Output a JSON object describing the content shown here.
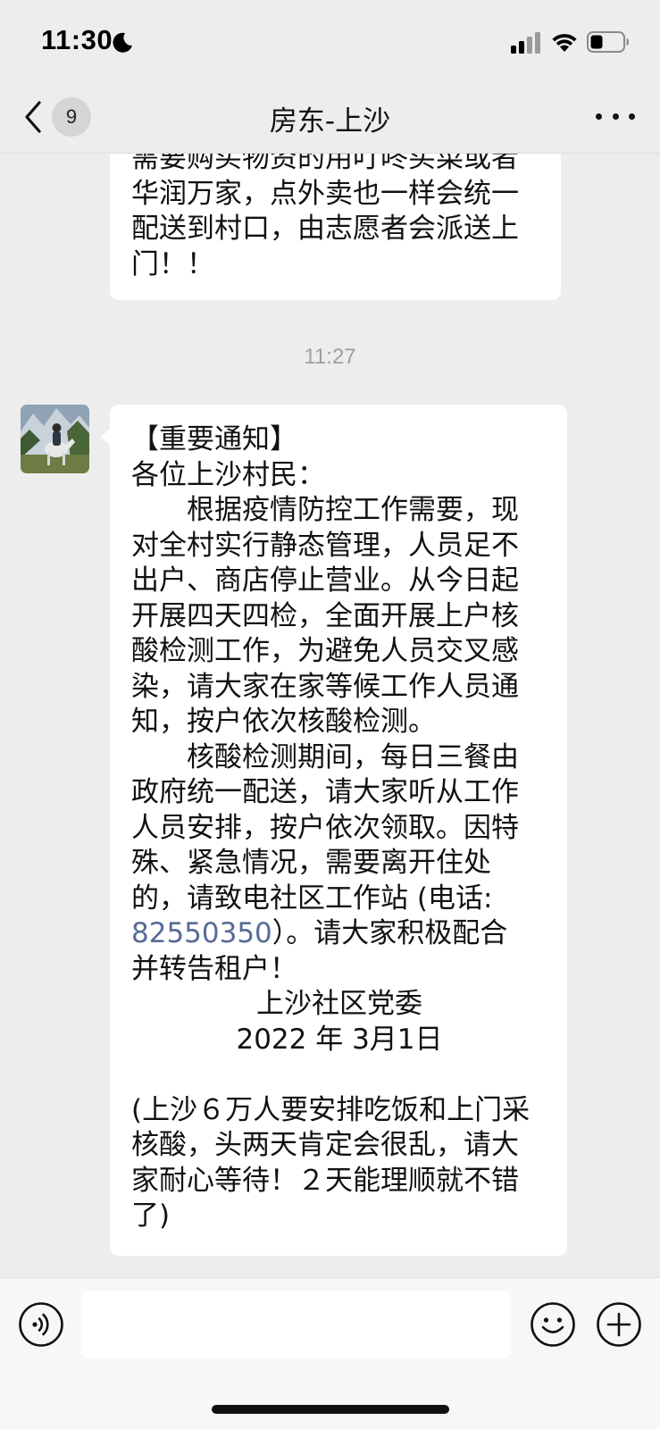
{
  "status_bar": {
    "time": "11:30",
    "icons": [
      "moon-icon",
      "signal-icon",
      "wifi-icon",
      "battery-icon"
    ]
  },
  "nav": {
    "back_icon": "chevron-left-icon",
    "unread_count": "9",
    "title": "房东-上沙",
    "more_icon": "more-dots-icon"
  },
  "messages": {
    "previous": {
      "lines": [
        "需要购买物资的用叮咚买菜或者",
        "华润万家，点外卖也一样会统一",
        "配送到村口，由志愿者会派送上",
        "门！！"
      ]
    },
    "time_separator": "11:27",
    "notice": {
      "sender_avatar": "avatar-rider-on-horse",
      "title_line": "【重要通知】",
      "greeting": "各位上沙村民：",
      "para1": [
        "根据疫情防控工作需要，现",
        "对全村实行静态管理，人员足不",
        "出户、商店停止营业。从今日起",
        "开展四天四检，全面开展上户核",
        "酸检测工作，为避免人员交叉感",
        "染，请大家在家等候工作人员通",
        "知，按户依次核酸检测。"
      ],
      "para2": [
        "核酸检测期间，每日三餐由",
        "政府统一配送，请大家听从工作",
        "人员安排，按户依次领取。因特",
        "殊、紧急情况，需要离开住处",
        "的，请致电社区工作站 (电话:"
      ],
      "phone": "82550350",
      "after_phone": "）。请大家积极配合",
      "last_line": "并转告租户！",
      "signature": "上沙社区党委",
      "date": "2022 年 3月1日",
      "note": [
        "(上沙６万人要安排吃饭和上门采",
        "核酸，头两天肯定会很乱，请大",
        "家耐心等待！２天能理顺就不错",
        "了)"
      ]
    }
  },
  "input_bar": {
    "voice_icon": "voice-icon",
    "input_value": "",
    "emoji_icon": "emoji-icon",
    "add_icon": "plus-circle-icon"
  },
  "colors": {
    "background": "#ededed",
    "bubble": "#ffffff",
    "link": "#576b95",
    "time_separator": "#9f9f9f"
  }
}
